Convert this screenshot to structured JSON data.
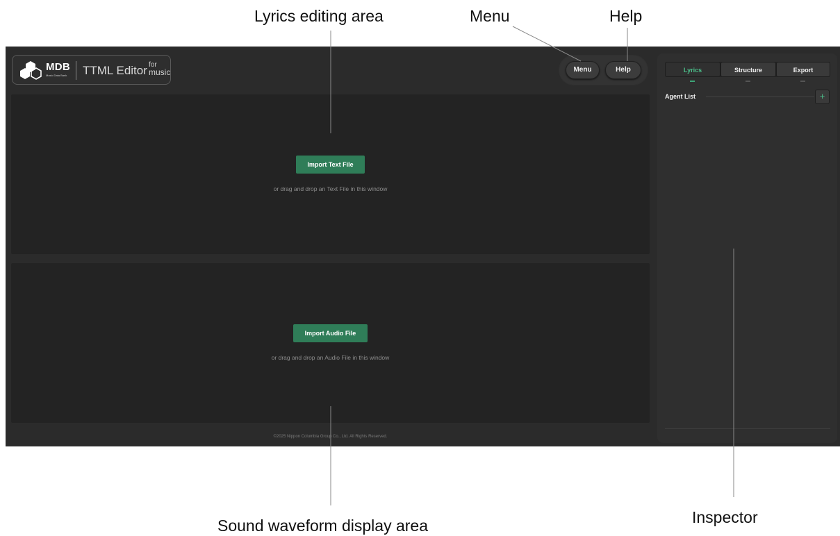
{
  "annotations": {
    "lyrics_area": "Lyrics editing area",
    "menu": "Menu",
    "help": "Help",
    "sound_area": "Sound waveform display area",
    "inspector": "Inspector"
  },
  "header": {
    "logo_brand": "MDB",
    "logo_subtitle": "Music Data Bank",
    "app_title": "TTML Editor",
    "app_title_suffix_1": "for",
    "app_title_suffix_2": "music",
    "menu_label": "Menu",
    "help_label": "Help"
  },
  "lyrics_panel": {
    "import_label": "Import Text File",
    "hint": "or drag and drop an Text File in this window"
  },
  "sound_panel": {
    "import_label": "Import Audio File",
    "hint": "or drag and drop an Audio File in this window"
  },
  "footer": {
    "copyright": "©2025 Nippon Columbia Group Co., Ltd. All Rights Reserved."
  },
  "inspector": {
    "tabs": [
      {
        "label": "Lyrics",
        "active": true
      },
      {
        "label": "Structure",
        "active": false
      },
      {
        "label": "Export",
        "active": false
      }
    ],
    "agent_list_label": "Agent List",
    "add_label": "+"
  },
  "colors": {
    "accent": "#2f7d58",
    "active_tab_text": "#4bbf8a",
    "background": "#2b2b2b",
    "panel": "#232323"
  },
  "icons": {
    "logo": "hexagon-cluster-icon",
    "add": "plus-icon"
  }
}
